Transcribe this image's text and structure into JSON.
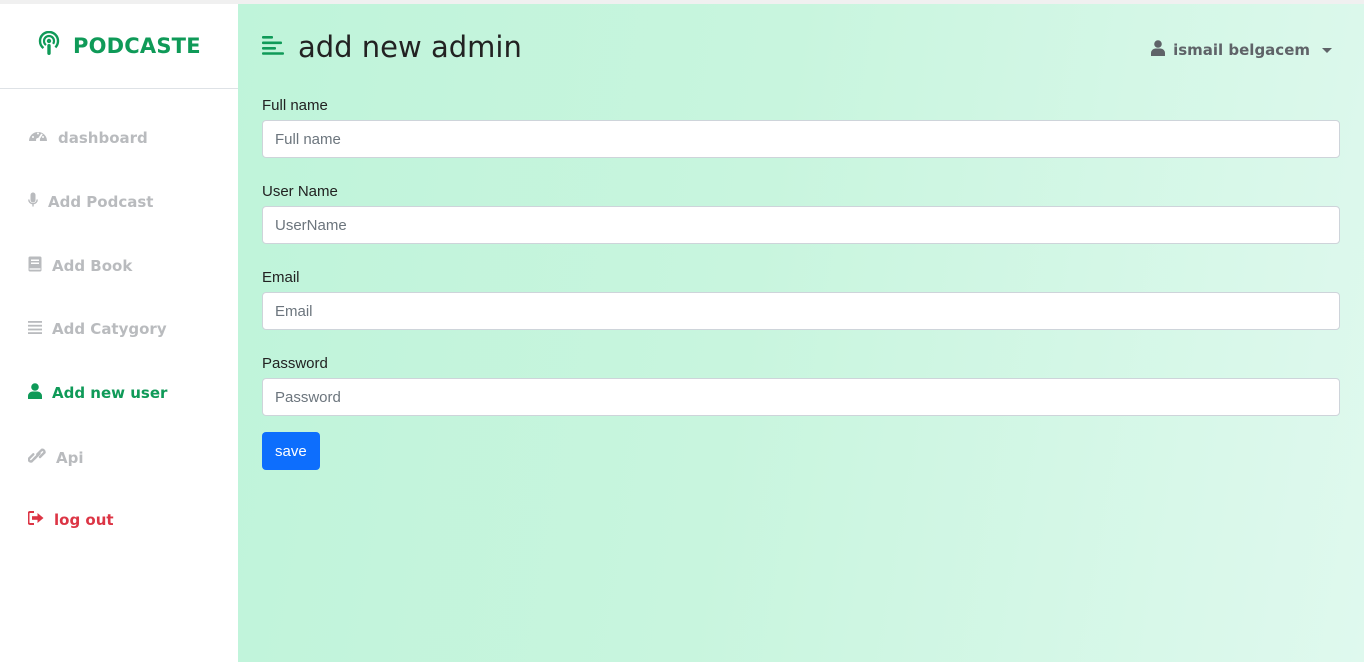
{
  "brand": {
    "name": "PODCASTE",
    "icon": "podcast-icon",
    "color": "#0f9a58"
  },
  "sidebar": {
    "items": [
      {
        "label": "dashboard",
        "icon": "gauge-icon"
      },
      {
        "label": "Add Podcast",
        "icon": "microphone-icon"
      },
      {
        "label": "Add Book",
        "icon": "book-icon"
      },
      {
        "label": "Add Catygory",
        "icon": "list-icon"
      },
      {
        "label": "Add new user",
        "icon": "user-icon",
        "active": true
      },
      {
        "label": "Api",
        "icon": "link-icon"
      },
      {
        "label": "log out",
        "icon": "sign-out-icon"
      }
    ]
  },
  "header": {
    "title": "add new admin",
    "menu_icon": "align-left-icon",
    "user": {
      "name": "ismail belgacem",
      "icon": "user-icon"
    }
  },
  "form": {
    "fields": [
      {
        "label": "Full name",
        "placeholder": "Full name",
        "value": ""
      },
      {
        "label": "User Name",
        "placeholder": "UserName",
        "value": ""
      },
      {
        "label": "Email",
        "placeholder": "Email",
        "value": ""
      },
      {
        "label": "Password",
        "placeholder": "Password",
        "value": ""
      }
    ],
    "submit_label": "save"
  },
  "colors": {
    "accent": "#0f9a58",
    "inactive": "#b9bbbe",
    "danger": "#dc3545",
    "primary_button": "#0d6efd"
  }
}
